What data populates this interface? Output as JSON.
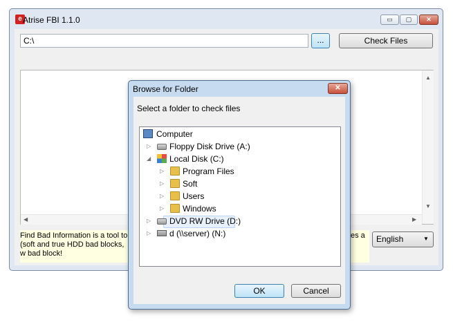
{
  "main_window": {
    "title": "Atrise FBI 1.1.0",
    "app_icon": "app-logo-icon",
    "caption_buttons": {
      "minimize": "▭",
      "maximize": "▢",
      "close": "✕"
    },
    "path_value": "C:\\",
    "browse_label": "...",
    "check_label": "Check Files",
    "info_left": "Find Bad Information is a tool to (soft and true HDD bad blocks, w bad block!",
    "info_right": "es a",
    "language": "English"
  },
  "dialog": {
    "title": "Browse for Folder",
    "close_glyph": "✕",
    "prompt": "Select a folder to check files",
    "tree": {
      "computer": "Computer",
      "floppy": "Floppy Disk Drive (A:)",
      "local_disk": "Local Disk (C:)",
      "program_files": "Program Files",
      "soft": "Soft",
      "users": "Users",
      "windows": "Windows",
      "dvd": "DVD RW Drive (D:)",
      "network": "d (\\\\server) (N:)"
    },
    "selected_node": "DVD RW Drive (D:)",
    "ok_label": "OK",
    "cancel_label": "Cancel"
  },
  "colors": {
    "accent": "#3c7fb1",
    "info_bg": "#ffffe1",
    "selection": "#e8f1fb"
  }
}
